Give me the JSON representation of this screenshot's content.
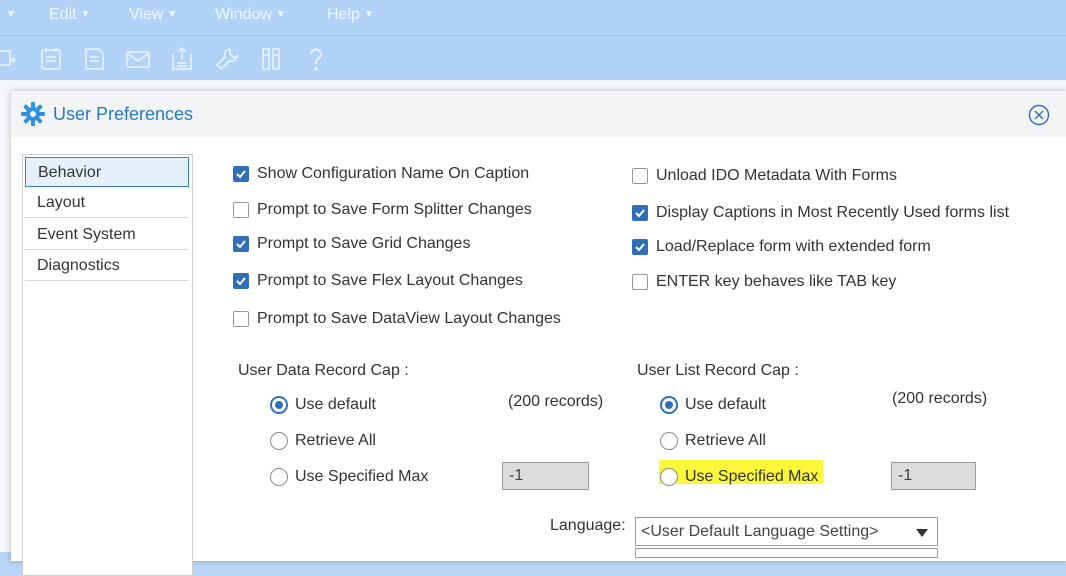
{
  "menu": [
    {
      "label": "Edit"
    },
    {
      "label": "View"
    },
    {
      "label": "Window"
    },
    {
      "label": "Help"
    }
  ],
  "toolbar_icons": [
    "new-record-icon",
    "form-icon",
    "document-icon",
    "mail-icon",
    "upload-document-icon",
    "wrench-icon",
    "columns-icon",
    "help-icon"
  ],
  "dialog": {
    "title": "User Preferences"
  },
  "nav": {
    "items": [
      {
        "label": "Behavior",
        "active": true
      },
      {
        "label": "Layout"
      },
      {
        "label": "Event System"
      },
      {
        "label": "Diagnostics"
      }
    ]
  },
  "options_left": [
    {
      "label": "Show Configuration Name On Caption",
      "checked": true
    },
    {
      "label": "Prompt to Save Form Splitter Changes",
      "checked": false
    },
    {
      "label": "Prompt to Save Grid Changes",
      "checked": true
    },
    {
      "label": "Prompt to Save Flex Layout Changes",
      "checked": true
    },
    {
      "label": "Prompt to Save DataView Layout Changes",
      "checked": false
    }
  ],
  "options_right": [
    {
      "label": "Unload IDO Metadata With Forms",
      "checked": false
    },
    {
      "label": "Display Captions in Most Recently Used forms list",
      "checked": true
    },
    {
      "label": "Load/Replace form with extended form",
      "checked": true
    },
    {
      "label": "ENTER key behaves like TAB key",
      "checked": false
    }
  ],
  "data_cap": {
    "label": "User Data Record Cap :",
    "default_label": "Use default",
    "records": "(200 records)",
    "retrieve_all": "Retrieve All",
    "specified": "Use Specified Max",
    "max_value": "-1",
    "selected": "default"
  },
  "list_cap": {
    "label": "User List Record Cap :",
    "default_label": "Use default",
    "records": "(200 records)",
    "retrieve_all": "Retrieve All",
    "specified": "Use Specified Max",
    "max_value": "-1",
    "selected": "default"
  },
  "language": {
    "label": "Language:",
    "value": "<User Default Language Setting>"
  },
  "colors": {
    "accent": "#2f6fb8",
    "title": "#2979c0",
    "highlight": "#fbf73a"
  }
}
